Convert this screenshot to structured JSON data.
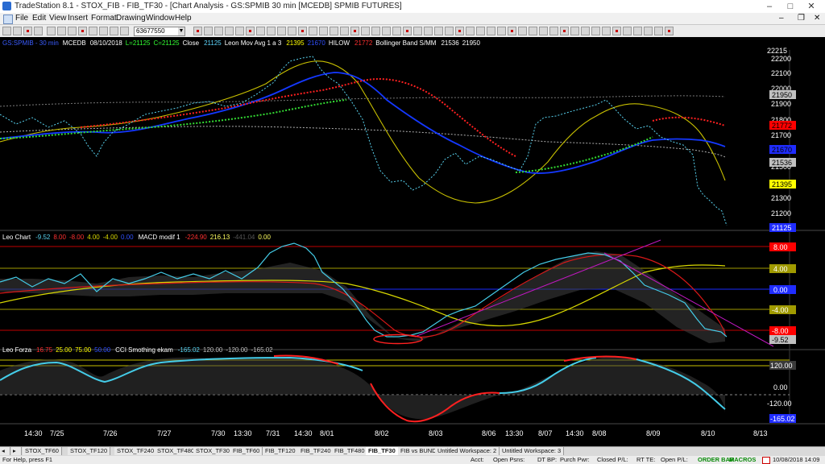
{
  "window": {
    "title": "TradeStation 8.1 - STOX_FIB - FIB_TF30 - [Chart Analysis - GS:SPMIB  30 min  [MCEDB] SPMIB FUTURES]",
    "minimize": "–",
    "maximize": "□",
    "close": "✕"
  },
  "menu": [
    "File",
    "Edit",
    "View",
    "Insert",
    "Format",
    "Drawing",
    "Window",
    "Help"
  ],
  "toolbar": {
    "symbol_value": "63677550"
  },
  "price_pane": {
    "header": {
      "symbol": "GS:SPMIB - 30 min",
      "exchange": "MCEDB",
      "date": "08/10/2018",
      "low": "L=21125",
      "close": "C=21125",
      "close_label": "Close",
      "close_value": "21125",
      "study1": "Leon Mov Avg 1 a 3",
      "study1_v1": "21395",
      "study1_v2": "21670",
      "study2": "HILOW",
      "study2_v": "21772",
      "study3": "Bollinger Band S/MM",
      "study3_v1": "21536",
      "study3_v2": "21950"
    },
    "top_value": "22215",
    "axis": [
      "22200",
      "22100",
      "22000",
      "21900",
      "21800",
      "21700",
      "21600",
      "21500",
      "21400",
      "21300",
      "21200",
      "21100"
    ],
    "tags": [
      "21950",
      "21772",
      "21670",
      "21536",
      "21395",
      "21125"
    ]
  },
  "leo_chart": {
    "header": {
      "name": "Leo Chart",
      "v1": "-9.52",
      "v2": "8.00",
      "v3": "-8.00",
      "v4": "4.00",
      "v5": "-4.00",
      "v6": "0.00",
      "macd": "MACD modif 1",
      "m1": "-224.90",
      "m2": "216.13",
      "m3": "-441.04",
      "m4": "0.00"
    },
    "tags": [
      "8.00",
      "4.00",
      "0.00",
      "-4.00",
      "-8.00",
      "-9.52"
    ]
  },
  "leo_forza": {
    "header": {
      "name": "Leo Forza",
      "v1": "16.75",
      "v2": "25.00",
      "v3": "75.00",
      "v4": "50.00",
      "cci": "CCI Smothing ekam",
      "c1": "-165.02",
      "c2": "120.00",
      "c3": "-120.00",
      "c4": "-165.02"
    },
    "tags": [
      "120.00",
      "0.00",
      "-120.00",
      "-165.02"
    ]
  },
  "time_axis": [
    "14:30",
    "7/25",
    "7/26",
    "7/27",
    "7/30",
    "13:30",
    "7/31",
    "14:30",
    "8/01",
    "8/02",
    "8/03",
    "8/06",
    "13:30",
    "8/07",
    "14:30",
    "8/08",
    "8/09",
    "8/10",
    "8/13"
  ],
  "tabs": [
    "STOX_TF60",
    "STOX_TF120",
    "STOX_TF240",
    "STOX_TF480",
    "STOX_TF30",
    "FIB_TF60",
    "FIB_TF120",
    "FIB_TF240",
    "FIB_TF480",
    "FIB_TF30",
    "FIB vs BUND",
    "Untitled Workspace: 2",
    "Untitled Workspace: 3"
  ],
  "status": {
    "help": "For Help, press F1",
    "acct": "Acct:",
    "open_psns": "Open Psns:",
    "dt_bp": "DT BP:",
    "purch_pwr": "Purch Pwr:",
    "closed_pl": "Closed P/L:",
    "rt_te": "RT TE:",
    "open_pl": "Open P/L:",
    "order_bar": "ORDER BAR",
    "macros": "MACROS",
    "clock": "10/08/2018 14:09"
  },
  "colors": {
    "price_dots": "#58d2ef",
    "blue_ma": "#1438ff",
    "yellow_ma": "#c8c000",
    "hilow_red": "#ff2020",
    "hilow_green": "#33dd33",
    "tag_blue": "#1f2cff",
    "tag_yellow": "#ffff00",
    "tag_red": "#ff0000",
    "tag_gray": "#c0c0c0"
  }
}
